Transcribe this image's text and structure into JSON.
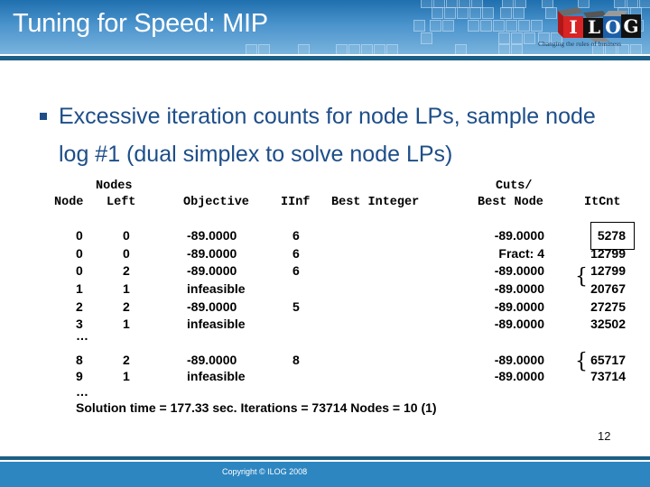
{
  "header": {
    "title": "Tuning for Speed: MIP",
    "logo": {
      "letters": [
        "I",
        "L",
        "O",
        "G"
      ],
      "tagline": "Changing the rules of business"
    },
    "colors": {
      "band_top": "#1f6fae",
      "band_bottom": "#79b3dd",
      "rule": "#1b5f86"
    }
  },
  "bullet": {
    "icon": "square-bullet-icon",
    "text": "Excessive iteration counts for node LPs, sample node log #1 (dual simplex to solve node LPs)",
    "color": "#1d4e89"
  },
  "log": {
    "headers": {
      "node": "Node",
      "nodes_left_1": "Nodes",
      "nodes_left_2": "Left",
      "objective": "Objective",
      "iinf": "IInf",
      "best_integer": "Best Integer",
      "cuts_1": "Cuts/",
      "cuts_2": "Best Node",
      "itcnt": "ItCnt"
    },
    "rows": [
      {
        "node": "0",
        "left": "0",
        "objective": "-89.0000",
        "iinf": "6",
        "best_integer": "",
        "best_node": "-89.0000",
        "itcnt": "5278"
      },
      {
        "node": "0",
        "left": "0",
        "objective": "-89.0000",
        "iinf": "6",
        "best_integer": "",
        "best_node": "Fract: 4",
        "itcnt": "12799"
      },
      {
        "node": "0",
        "left": "2",
        "objective": "-89.0000",
        "iinf": "6",
        "best_integer": "",
        "best_node": "-89.0000",
        "itcnt": "12799"
      },
      {
        "node": "1",
        "left": "1",
        "objective": "infeasible",
        "iinf": "",
        "best_integer": "",
        "best_node": "-89.0000",
        "itcnt": "20767"
      },
      {
        "node": "2",
        "left": "2",
        "objective": "-89.0000",
        "iinf": "5",
        "best_integer": "",
        "best_node": "-89.0000",
        "itcnt": "27275"
      },
      {
        "node": "3",
        "left": "1",
        "objective": "infeasible",
        "iinf": "",
        "best_integer": "",
        "best_node": "-89.0000",
        "itcnt": "32502"
      }
    ],
    "ellipsis_1": "…",
    "rows2": [
      {
        "node": "8",
        "left": "2",
        "objective": "-89.0000",
        "iinf": "8",
        "best_integer": "",
        "best_node": "-89.0000",
        "itcnt": "65717"
      },
      {
        "node": "9",
        "left": "1",
        "objective": "infeasible",
        "iinf": "",
        "best_integer": "",
        "best_node": "-89.0000",
        "itcnt": "73714"
      }
    ],
    "ellipsis_2": "…",
    "summary": "Solution time =  177.33 sec.  Iterations = 73714  Nodes = 10 (1)",
    "annotations": {
      "highlight_box_on": "5278",
      "brace_1": "{",
      "brace_2": "{"
    }
  },
  "footer": {
    "copyright": "Copyright © ILOG 2008",
    "page_number": "12",
    "color": "#2e86c1"
  }
}
